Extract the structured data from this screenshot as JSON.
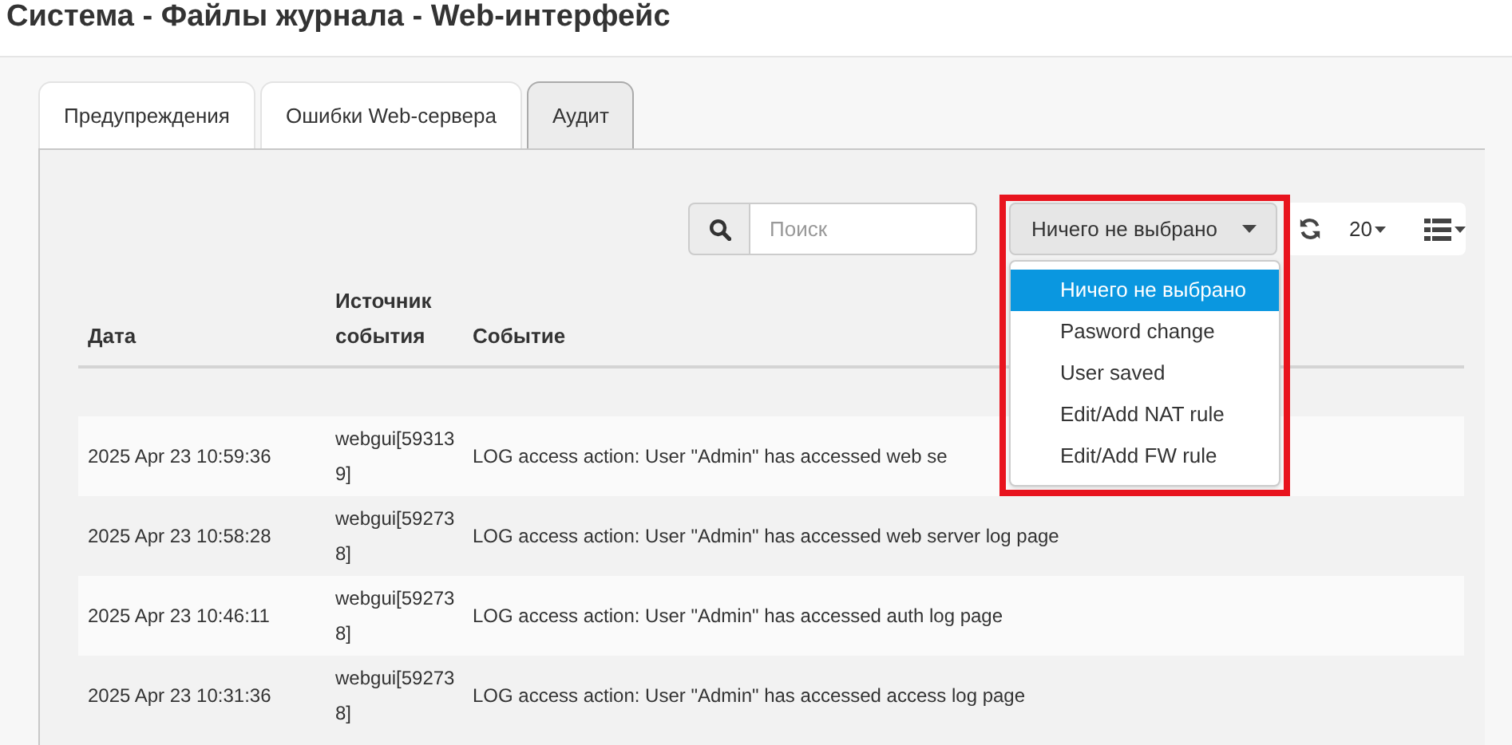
{
  "page_title": "Система - Файлы журнала - Web-интерфейс",
  "tabs": [
    {
      "label": "Предупреждения",
      "selected": false
    },
    {
      "label": "Ошибки Web-сервера",
      "selected": false
    },
    {
      "label": "Аудит",
      "selected": true
    }
  ],
  "search": {
    "placeholder": "Поиск"
  },
  "filter": {
    "value": "Ничего не выбрано",
    "expanded": true,
    "options": [
      {
        "label": "Ничего не выбрано",
        "selected": true
      },
      {
        "label": "Pasword change",
        "selected": false
      },
      {
        "label": "User saved",
        "selected": false
      },
      {
        "label": "Edit/Add NAT rule",
        "selected": false
      },
      {
        "label": "Edit/Add FW rule",
        "selected": false
      }
    ]
  },
  "page_size": "20",
  "table": {
    "columns": [
      "Дата",
      "Источник события",
      "Событие"
    ],
    "rows": [
      {
        "date": "2025 Apr 23 10:59:36",
        "source": "webgui[593139]",
        "event": "LOG access action: User \"Admin\" has accessed web se"
      },
      {
        "date": "2025 Apr 23 10:58:28",
        "source": "webgui[592738]",
        "event": "LOG access action: User \"Admin\" has accessed web server log page"
      },
      {
        "date": "2025 Apr 23 10:46:11",
        "source": "webgui[592738]",
        "event": "LOG access action: User \"Admin\" has accessed auth log page"
      },
      {
        "date": "2025 Apr 23 10:31:36",
        "source": "webgui[592738]",
        "event": "LOG access action: User \"Admin\" has accessed access log page"
      }
    ]
  }
}
